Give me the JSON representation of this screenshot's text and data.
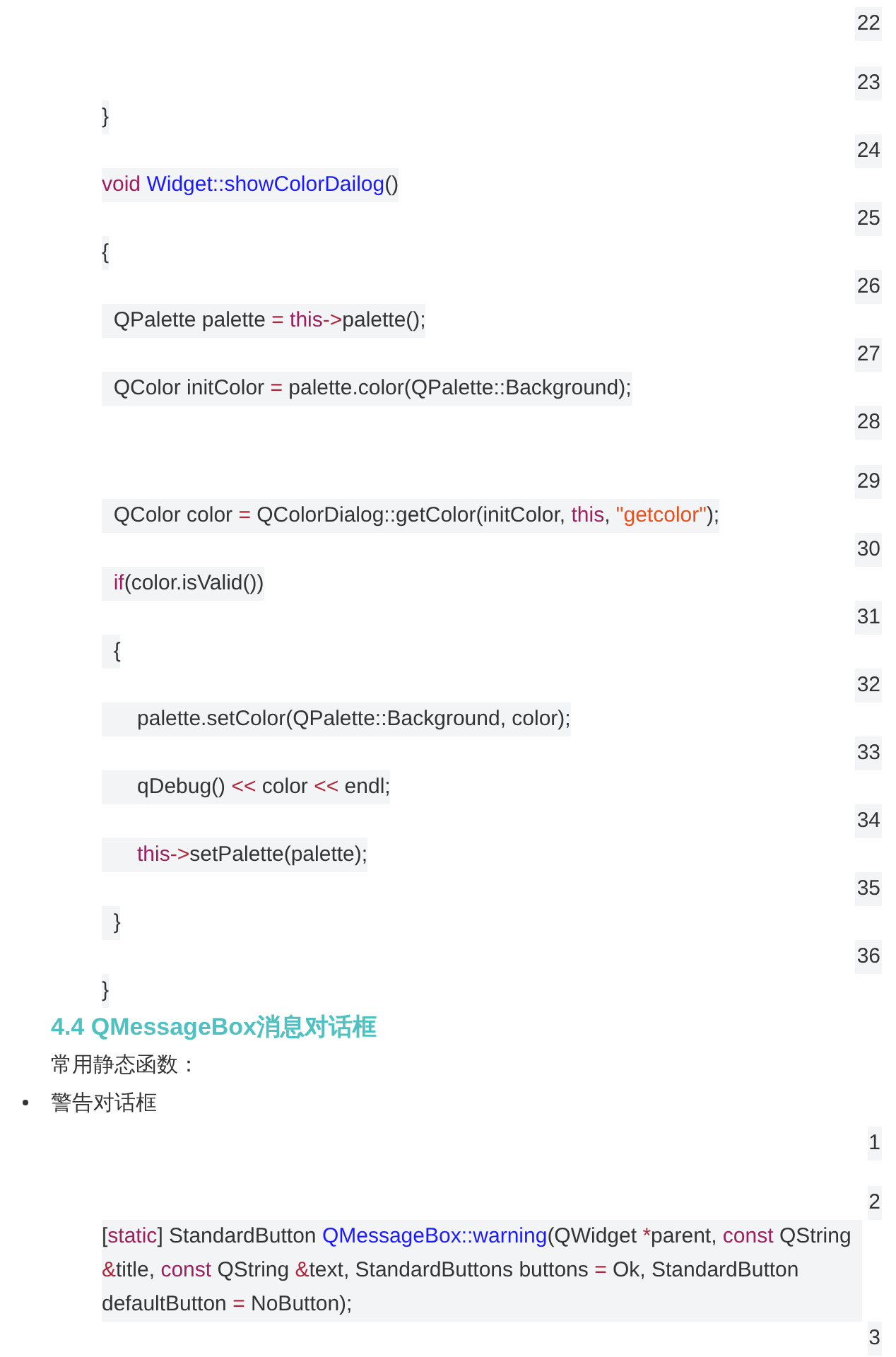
{
  "code_block_1": {
    "lines": [
      {
        "number": "22"
      },
      {
        "number": "23",
        "code": [
          {
            "kind": "plain",
            "text": "}"
          }
        ]
      },
      {
        "number": "24",
        "code": [
          {
            "kind": "keyword",
            "text": "void"
          },
          {
            "kind": "function",
            "text": " Widget::showColorDailog"
          },
          {
            "kind": "plain",
            "text": "()"
          }
        ]
      },
      {
        "number": "25",
        "code": [
          {
            "kind": "plain",
            "text": "{"
          }
        ]
      },
      {
        "number": "26",
        "code": [
          {
            "kind": "plain",
            "text": "  QPalette palette "
          },
          {
            "kind": "operator",
            "text": "="
          },
          {
            "kind": "keyword",
            "text": " this"
          },
          {
            "kind": "operator",
            "text": "->"
          },
          {
            "kind": "plain",
            "text": "palette();"
          }
        ]
      },
      {
        "number": "27",
        "code": [
          {
            "kind": "plain",
            "text": "  QColor initColor "
          },
          {
            "kind": "operator",
            "text": "="
          },
          {
            "kind": "plain",
            "text": " palette.color(QPalette::Background);"
          }
        ]
      },
      {
        "number": "28"
      },
      {
        "number": "29",
        "code": [
          {
            "kind": "plain",
            "text": "  QColor color "
          },
          {
            "kind": "operator",
            "text": "="
          },
          {
            "kind": "plain",
            "text": " QColorDialog::getColor(initColor, "
          },
          {
            "kind": "keyword",
            "text": "this"
          },
          {
            "kind": "plain",
            "text": ", "
          },
          {
            "kind": "string",
            "text": "\"getcolor\""
          },
          {
            "kind": "plain",
            "text": ");"
          }
        ]
      },
      {
        "number": "30",
        "code": [
          {
            "kind": "keyword",
            "text": "  if"
          },
          {
            "kind": "plain",
            "text": "(color.isValid())"
          }
        ]
      },
      {
        "number": "31",
        "code": [
          {
            "kind": "plain",
            "text": "  {"
          }
        ]
      },
      {
        "number": "32",
        "code": [
          {
            "kind": "plain",
            "text": "      palette.setColor(QPalette::Background, color);"
          }
        ]
      },
      {
        "number": "33",
        "code": [
          {
            "kind": "plain",
            "text": "      qDebug() "
          },
          {
            "kind": "operator",
            "text": "<<"
          },
          {
            "kind": "plain",
            "text": " color "
          },
          {
            "kind": "operator",
            "text": "<<"
          },
          {
            "kind": "plain",
            "text": " endl;"
          }
        ]
      },
      {
        "number": "34",
        "code": [
          {
            "kind": "keyword",
            "text": "      this"
          },
          {
            "kind": "operator",
            "text": "->"
          },
          {
            "kind": "plain",
            "text": "setPalette(palette);"
          }
        ]
      },
      {
        "number": "35",
        "code": [
          {
            "kind": "plain",
            "text": "  }"
          }
        ]
      },
      {
        "number": "36",
        "code": [
          {
            "kind": "plain",
            "text": "}"
          }
        ]
      }
    ]
  },
  "heading": "4.4 QMessageBox消息对话框",
  "paragraph": "常用静态函数：",
  "bullets": [
    "警告对话框"
  ],
  "code_block_2": {
    "lines": [
      {
        "number": "1"
      },
      {
        "number": "2",
        "code": [
          {
            "kind": "plain",
            "text": "["
          },
          {
            "kind": "keyword",
            "text": "static"
          },
          {
            "kind": "plain",
            "text": "] StandardButton "
          },
          {
            "kind": "function",
            "text": "QMessageBox::warning"
          },
          {
            "kind": "plain",
            "text": "(QWidget "
          },
          {
            "kind": "operator",
            "text": "*"
          },
          {
            "kind": "plain",
            "text": "parent, "
          },
          {
            "kind": "keyword",
            "text": "const"
          },
          {
            "kind": "plain",
            "text": " QString "
          },
          {
            "kind": "operator",
            "text": "&"
          },
          {
            "kind": "plain",
            "text": "title, "
          },
          {
            "kind": "keyword",
            "text": "const"
          },
          {
            "kind": "plain",
            "text": " QString "
          },
          {
            "kind": "operator",
            "text": "&"
          },
          {
            "kind": "plain",
            "text": "text, StandardButtons buttons "
          },
          {
            "kind": "operator",
            "text": "="
          },
          {
            "kind": "plain",
            "text": " Ok, StandardButton defaultButton "
          },
          {
            "kind": "operator",
            "text": "="
          },
          {
            "kind": "plain",
            "text": " NoButton);"
          }
        ]
      },
      {
        "number": "3"
      }
    ]
  }
}
